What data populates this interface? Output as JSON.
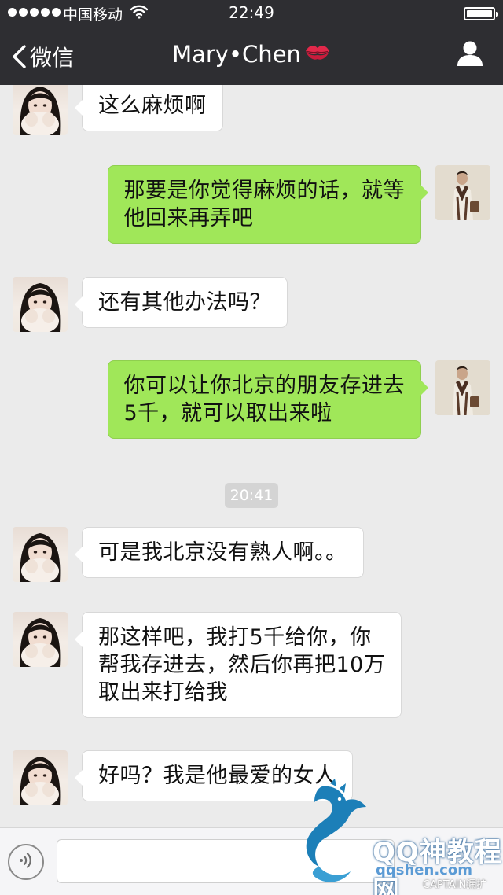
{
  "status_bar": {
    "carrier": "中国移动",
    "time": "22:49",
    "signal_icon": "signal-dots-icon",
    "wifi_icon": "wifi-icon",
    "battery_icon": "battery-icon"
  },
  "nav": {
    "back_label": "微信",
    "title": "Mary•Chen",
    "title_emoji": "kiss-lips-icon",
    "back_icon": "chevron-left-icon",
    "profile_icon": "person-icon"
  },
  "messages": [
    {
      "from": "contact",
      "lines": [
        "这么麻烦啊"
      ]
    },
    {
      "from": "me",
      "lines": [
        "那要是你觉得麻烦的话，就等",
        "他回来再弄吧"
      ]
    },
    {
      "from": "contact",
      "lines": [
        "还有其他办法吗？"
      ]
    },
    {
      "from": "me",
      "lines": [
        "你可以让你北京的朋友存进去",
        "5千，就可以取出来啦"
      ]
    },
    {
      "from": "contact",
      "lines": [
        "可是我北京没有熟人啊。。"
      ]
    },
    {
      "from": "contact",
      "lines": [
        "那这样吧，我打5千给你，你",
        "帮我存进去，然后你再把10万",
        "取出来打给我"
      ]
    },
    {
      "from": "contact",
      "lines": [
        "好吗？我是他最爱的女人"
      ]
    }
  ],
  "timestamp": "20:41",
  "input_bar": {
    "voice_icon": "voice-icon",
    "text_value": ""
  },
  "watermark": {
    "brand": "QQ神教程网",
    "url": "qqshen.com",
    "caption": "CAPTAIN漏扩"
  },
  "colors": {
    "nav_bg": "#2e2e32",
    "chat_bg": "#ebebeb",
    "my_bubble": "#a0e759",
    "their_bubble": "#ffffff"
  }
}
